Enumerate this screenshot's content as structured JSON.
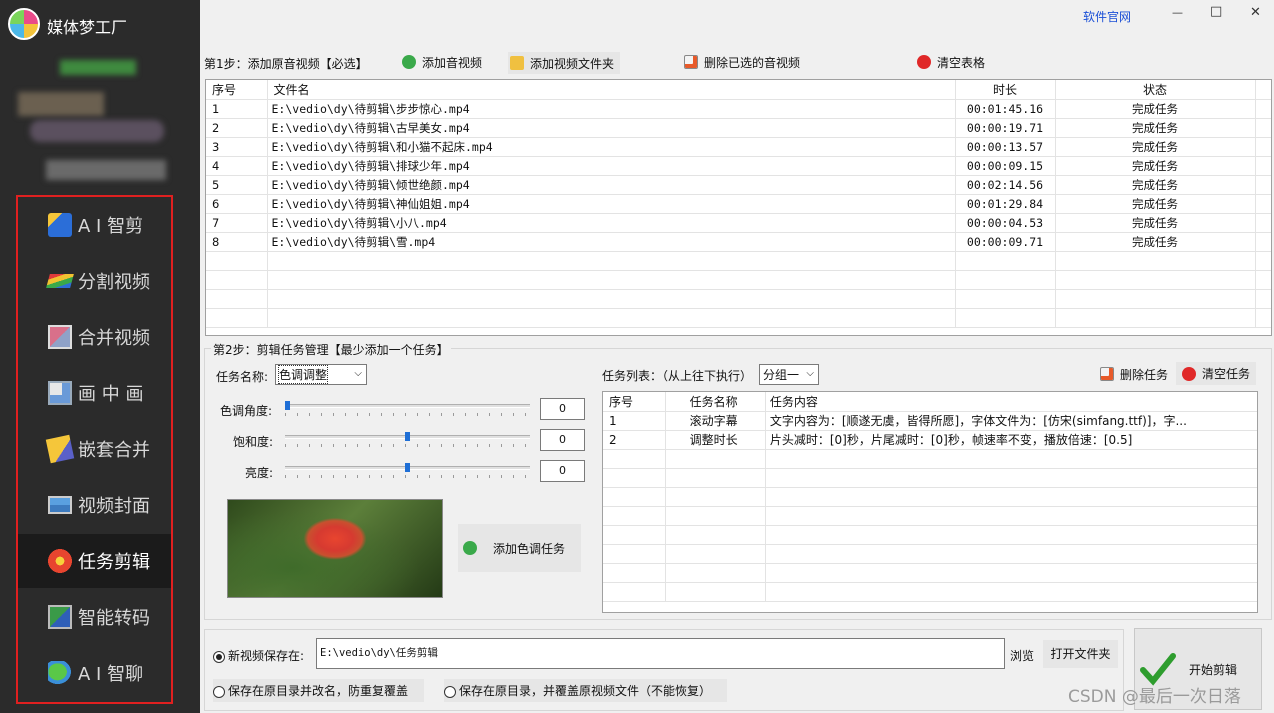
{
  "app": {
    "title": "媒体梦工厂",
    "official_site_link": "软件官网"
  },
  "window_controls": {
    "minimize": "—",
    "maximize": "□",
    "close": "✕"
  },
  "sidebar": {
    "items": [
      {
        "label": "A I 智剪",
        "icon": "ai-cut-icon",
        "active": false
      },
      {
        "label": "分割视频",
        "icon": "split-video-icon",
        "active": false
      },
      {
        "label": "合并视频",
        "icon": "merge-video-icon",
        "active": false
      },
      {
        "label": "画 中 画",
        "icon": "picture-in-picture-icon",
        "active": false
      },
      {
        "label": "嵌套合并",
        "icon": "nested-merge-icon",
        "active": false
      },
      {
        "label": "视频封面",
        "icon": "video-cover-icon",
        "active": false
      },
      {
        "label": "任务剪辑",
        "icon": "flower-icon",
        "active": true
      },
      {
        "label": "智能转码",
        "icon": "transcode-icon",
        "active": false
      },
      {
        "label": "A I 智聊",
        "icon": "chat-icon",
        "active": false
      }
    ]
  },
  "step1": {
    "label": "第1步：添加原音视频【必选】",
    "buttons": {
      "add_video": "添加音视频",
      "add_folder": "添加视频文件夹",
      "delete_selected": "删除已选的音视频",
      "clear_table": "清空表格"
    },
    "columns": [
      "序号",
      "文件名",
      "时长",
      "状态"
    ],
    "rows": [
      {
        "no": "1",
        "file": "E:\\vedio\\dy\\待剪辑\\步步惊心.mp4",
        "duration": "00:01:45.16",
        "status": "完成任务"
      },
      {
        "no": "2",
        "file": "E:\\vedio\\dy\\待剪辑\\古早美女.mp4",
        "duration": "00:00:19.71",
        "status": "完成任务"
      },
      {
        "no": "3",
        "file": "E:\\vedio\\dy\\待剪辑\\和小猫不起床.mp4",
        "duration": "00:00:13.57",
        "status": "完成任务"
      },
      {
        "no": "4",
        "file": "E:\\vedio\\dy\\待剪辑\\排球少年.mp4",
        "duration": "00:00:09.15",
        "status": "完成任务"
      },
      {
        "no": "5",
        "file": "E:\\vedio\\dy\\待剪辑\\倾世绝颜.mp4",
        "duration": "00:02:14.56",
        "status": "完成任务"
      },
      {
        "no": "6",
        "file": "E:\\vedio\\dy\\待剪辑\\神仙姐姐.mp4",
        "duration": "00:01:29.84",
        "status": "完成任务"
      },
      {
        "no": "7",
        "file": "E:\\vedio\\dy\\待剪辑\\小八.mp4",
        "duration": "00:00:04.53",
        "status": "完成任务"
      },
      {
        "no": "8",
        "file": "E:\\vedio\\dy\\待剪辑\\雪.mp4",
        "duration": "00:00:09.71",
        "status": "完成任务"
      }
    ]
  },
  "step2": {
    "label": "第2步：剪辑任务管理【最少添加一个任务】",
    "task_name_label": "任务名称:",
    "task_name_value": "色调调整",
    "sliders": [
      {
        "label": "色调角度:",
        "value": "0",
        "level": 0.0
      },
      {
        "label": "饱和度:",
        "value": "0",
        "level": 0.5
      },
      {
        "label": "亮度:",
        "value": "0",
        "level": 0.5
      }
    ],
    "add_color_task": "添加色调任务",
    "task_list_label": "任务列表：（从上往下执行）",
    "group_value": "分组一",
    "delete_task": "删除任务",
    "clear_tasks": "清空任务",
    "columns": [
      "序号",
      "任务名称",
      "任务内容"
    ],
    "rows": [
      {
        "no": "1",
        "name": "滚动字幕",
        "content": "文字内容为：[顺遂无虞，皆得所愿]，字体文件为：[仿宋(simfang.ttf)]，字..."
      },
      {
        "no": "2",
        "name": "调整时长",
        "content": "片头减时：[0]秒，片尾减时：[0]秒，帧速率不变，播放倍速：[0.5]"
      }
    ]
  },
  "output": {
    "option_new_save": "新视频保存在:",
    "save_path": "E:\\vedio\\dy\\任务剪辑",
    "browse": "浏览",
    "open_folder": "打开文件夹",
    "option_rename": "保存在原目录并改名，防重复覆盖",
    "option_overwrite": "保存在原目录，并覆盖原视频文件（不能恢复）",
    "start_button": "开始剪辑"
  },
  "watermark": "CSDN @最后一次日落",
  "colors": {
    "sidebar_bg": "#2b2b2b",
    "highlight_box": "#e02020",
    "link_blue": "#1a4fd6"
  }
}
